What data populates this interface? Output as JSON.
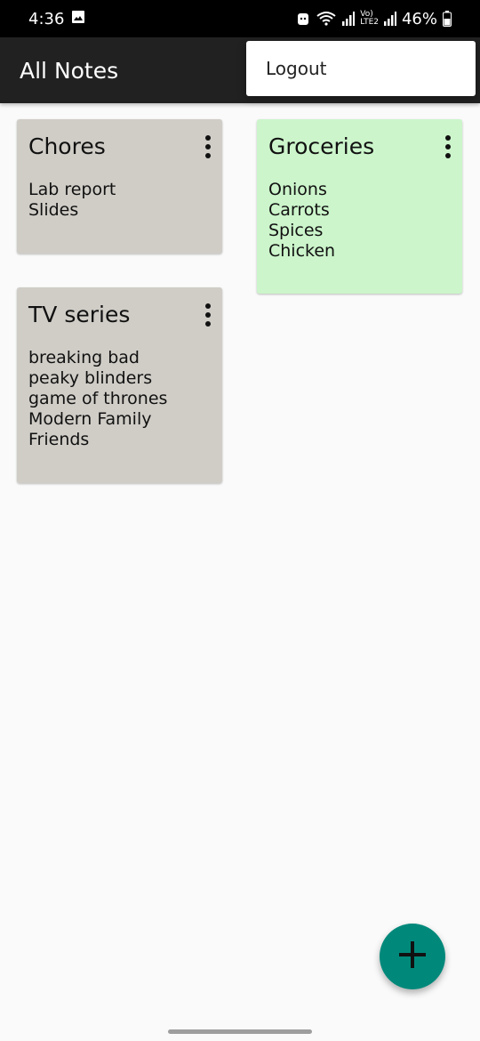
{
  "status_bar": {
    "time": "4:36",
    "battery": "46%",
    "network_label_top": "Vo)",
    "network_label_bottom": "LTE2"
  },
  "app_bar": {
    "title": "All Notes"
  },
  "menu": {
    "items": [
      {
        "label": "Logout"
      }
    ]
  },
  "notes": [
    {
      "title": "Chores",
      "lines": [
        "Lab report",
        "Slides"
      ],
      "color": "#d0cdc7"
    },
    {
      "title": "Groceries",
      "lines": [
        "Onions",
        "Carrots",
        "Spices",
        "Chicken"
      ],
      "color": "#ccf5cb"
    },
    {
      "title": "TV series",
      "lines": [
        "breaking bad",
        "peaky blinders",
        "game of thrones",
        "Modern Family",
        "Friends"
      ],
      "color": "#d0cdc7"
    }
  ],
  "fab": {
    "icon": "plus-icon",
    "color": "#00897b"
  },
  "icons": {
    "status_left": "image-icon",
    "status_right": [
      "android-icon",
      "wifi-icon",
      "signal-icon",
      "signal-icon",
      "battery-icon"
    ],
    "note_menu": "more-vert-icon"
  }
}
